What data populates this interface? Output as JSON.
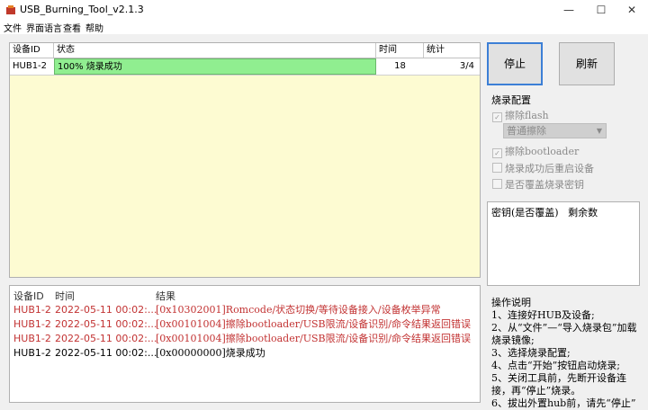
{
  "window": {
    "title": "USB_Burning_Tool_v2.1.3",
    "minimize": "—",
    "maximize": "☐",
    "close": "✕"
  },
  "menu": [
    "文件",
    "界面语言",
    "查看",
    "帮助"
  ],
  "device_table": {
    "headers": [
      "设备ID",
      "状态",
      "时间",
      "统计"
    ],
    "rows": [
      {
        "id": "HUB1-2",
        "status": "100% 烧录成功",
        "progress": 1.0,
        "time": "18",
        "count": "3/4"
      }
    ]
  },
  "buttons": {
    "stop": "停止",
    "refresh": "刷新"
  },
  "burn_config": {
    "title": "烧录配置",
    "erase_flash": "擦除flash",
    "erase_mode": "普通擦除",
    "erase_bootloader": "擦除bootloader",
    "reboot_after": "烧录成功后重启设备",
    "overwrite_key": "是否覆盖烧录密钥"
  },
  "key_table": {
    "header": "密钥(是否覆盖)   剩余数"
  },
  "log": {
    "headers": [
      "设备ID",
      "时间",
      "结果"
    ],
    "rows": [
      {
        "id": "HUB1-2",
        "time": "2022-05-11 00:02:...",
        "code": "[0x10302001]",
        "msg": "Romcode/状态切换/等待设备接入/设备枚举异常",
        "error": true
      },
      {
        "id": "HUB1-2",
        "time": "2022-05-11 00:02:...",
        "code": "[0x00101004]",
        "msg": "擦除bootloader/USB限流/设备识别/命令结果返回错误",
        "error": true
      },
      {
        "id": "HUB1-2",
        "time": "2022-05-11 00:02:...",
        "code": "[0x00101004]",
        "msg": "擦除bootloader/USB限流/设备识别/命令结果返回错误",
        "error": true
      },
      {
        "id": "HUB1-2",
        "time": "2022-05-11 00:02:...",
        "code": "[0x00000000]",
        "msg": "烧录成功",
        "error": false
      }
    ]
  },
  "instructions": {
    "title": "操作说明",
    "lines": [
      "1、连接好HUB及设备;",
      "2、从“文件”—“导入烧录包”加载烧录镜像;",
      "3、选择烧录配置;",
      "4、点击“开始”按钮启动烧录;",
      "5、关闭工具前，先断开设备连接，再“停止”烧录。",
      "6、拔出外置hub前，请先“停止”"
    ]
  }
}
